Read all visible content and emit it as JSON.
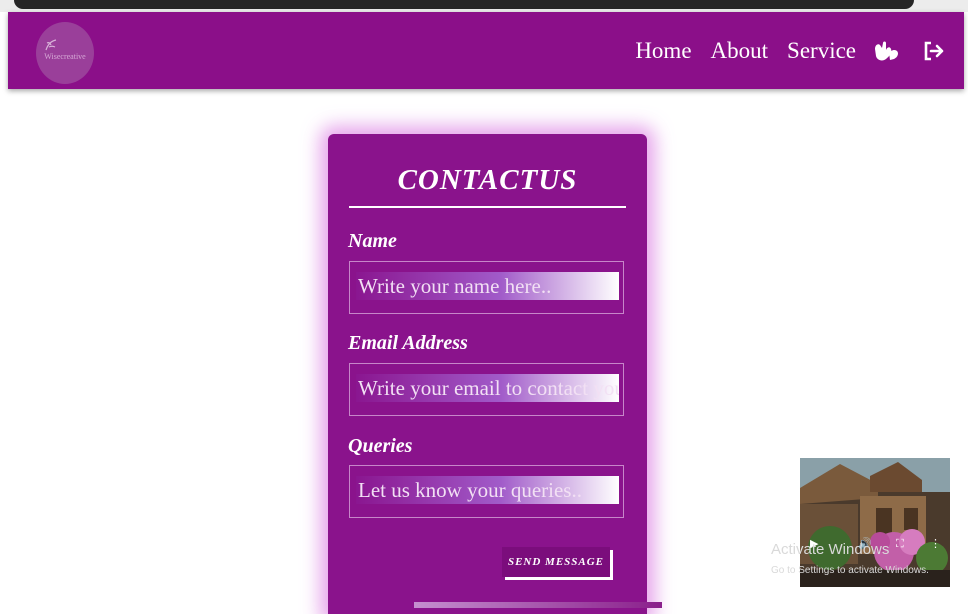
{
  "nav": {
    "logo_text": "Wisecreative",
    "links": [
      "Home",
      "About",
      "Service"
    ],
    "sign_language_icon": "sign-language-icon",
    "logout_icon": "logout-arrow-icon"
  },
  "contact": {
    "title": "CONTACTUS",
    "fields": [
      {
        "label": "Name",
        "placeholder": "Write your name here.."
      },
      {
        "label": "Email Address",
        "placeholder": "Write your email to contact you"
      },
      {
        "label": "Queries",
        "placeholder": "Let us know your queries.."
      }
    ],
    "submit_label": "SEND MESSAGE"
  },
  "video_popup": {
    "icons": [
      "play-icon",
      "volume-icon",
      "fullscreen-icon",
      "more-options-icon"
    ]
  },
  "watermark": {
    "title": "Activate Windows",
    "subtitle": "Go to Settings to activate Windows."
  },
  "colors": {
    "nav_bg": "#8b0f89",
    "card_bg": "#8a138c",
    "card_glow": "#de87e4",
    "text": "#ffffff"
  }
}
